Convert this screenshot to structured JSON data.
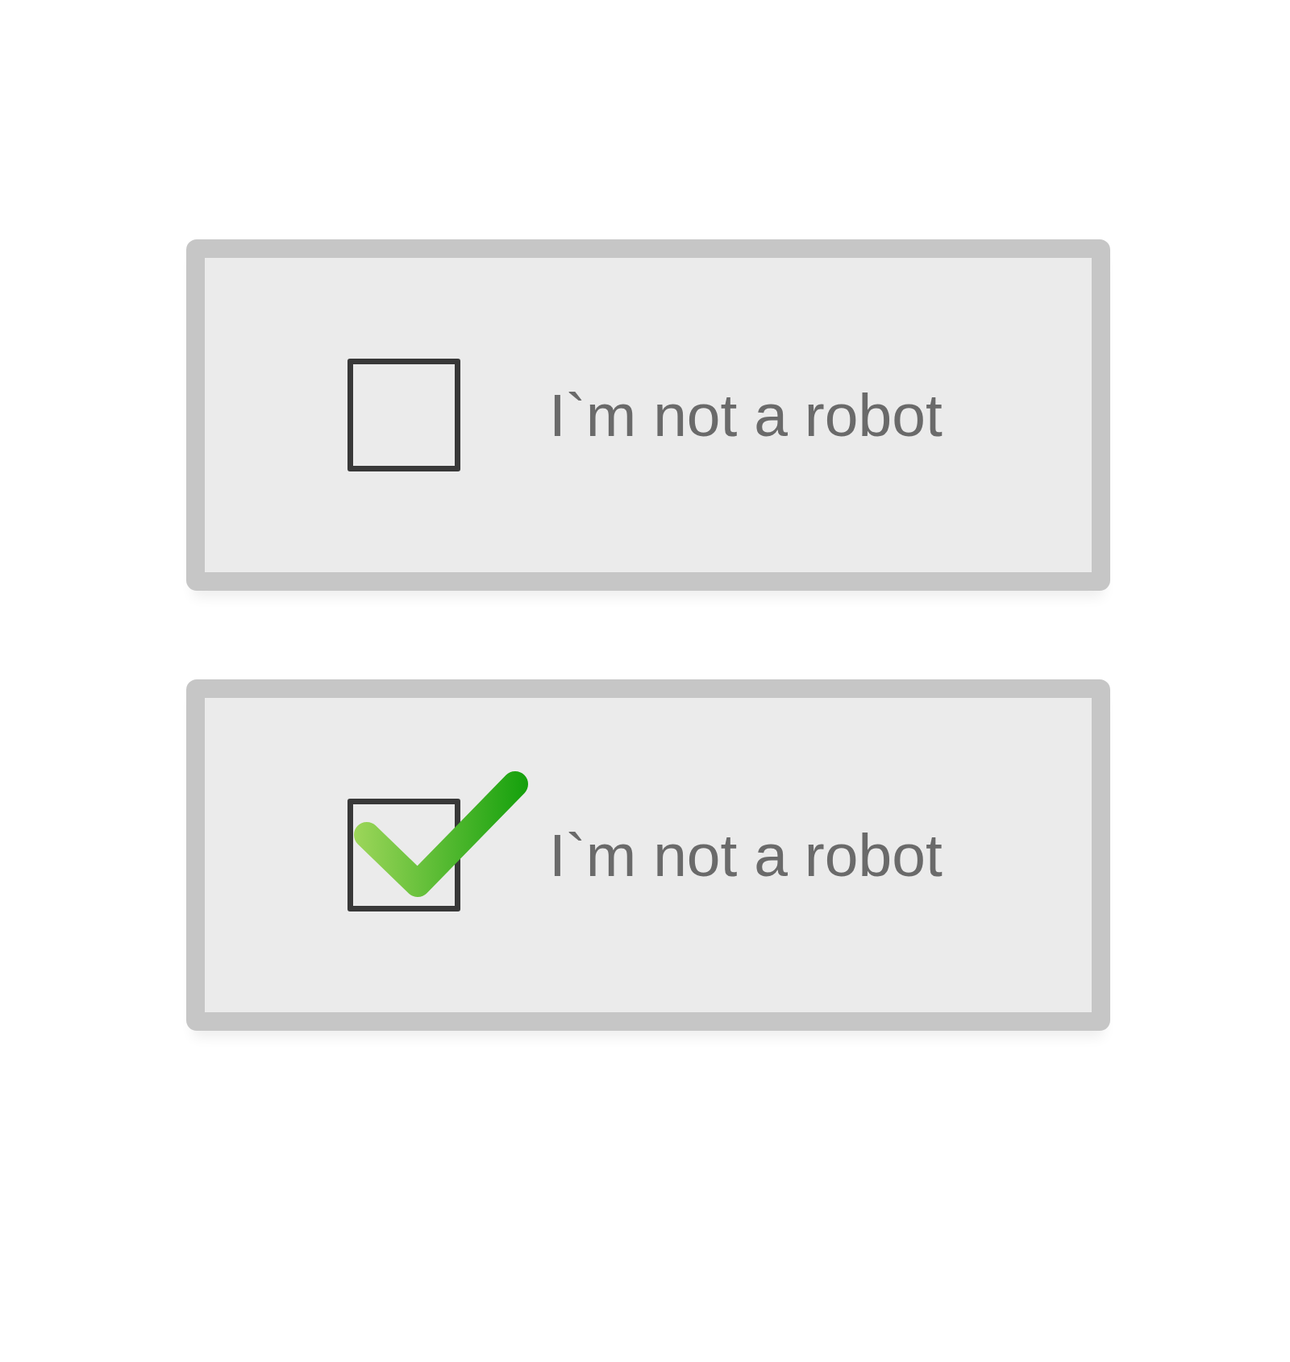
{
  "captcha_widgets": [
    {
      "label": "I`m not a robot",
      "checked": false
    },
    {
      "label": "I`m not a robot",
      "checked": true
    }
  ]
}
